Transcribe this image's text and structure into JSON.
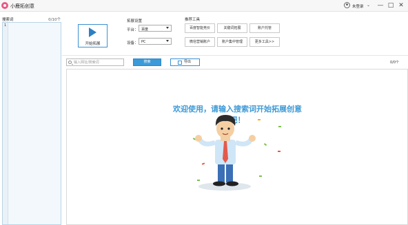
{
  "app": {
    "title": "小鹿拓创意"
  },
  "titlebar": {
    "user_status": "未登录",
    "minimize": "—",
    "maximize": "□",
    "close": "✕"
  },
  "sidebar": {
    "title": "搜索词",
    "count": "0/10个",
    "line_number": "1"
  },
  "start": {
    "label": "开始拓展"
  },
  "expand_settings": {
    "title": "拓展设置",
    "platform_label": "平台：",
    "platform_value": "百度",
    "device_label": "设备：",
    "device_value": "PC"
  },
  "tools": {
    "title": "推荐工具",
    "items": [
      "百度智能竞价",
      "关键词拓展",
      "账户托管",
      "微信营销账户",
      "账户集中管理",
      "更多工具>>"
    ]
  },
  "search": {
    "placeholder": "输入网址/搜索词",
    "search_label": "搜索",
    "export_label": "导出",
    "result_count": "0/0个"
  },
  "content": {
    "welcome": "欢迎使用，请输入搜索词开始拓展创意吧！"
  },
  "icons": {
    "logo": "app-logo-icon",
    "user": "user-icon",
    "play": "play-icon",
    "search": "search-icon",
    "export": "export-icon"
  },
  "colors": {
    "accent": "#3b9ad9",
    "welcome_text": "#3d9ad6",
    "logo": "#e85a86"
  }
}
